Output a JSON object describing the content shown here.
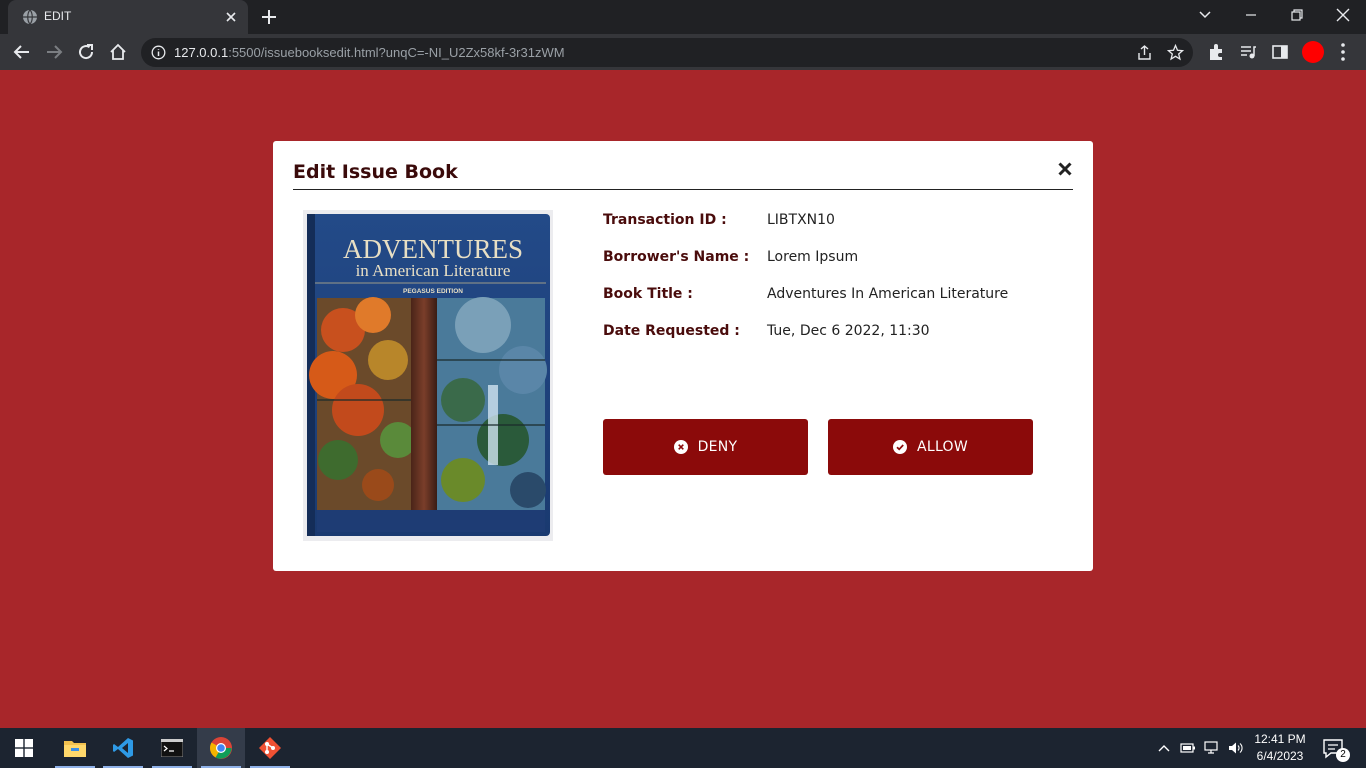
{
  "browser": {
    "tab_title": "EDIT",
    "url_host": "127.0.0.1",
    "url_rest": ":5500/issuebooksedit.html?unqC=-NI_U2Zx58kf-3r31zWM"
  },
  "modal": {
    "title": "Edit Issue Book",
    "details": [
      {
        "label": "Transaction ID :",
        "value": "LIBTXN10"
      },
      {
        "label": "Borrower's Name :",
        "value": "Lorem Ipsum"
      },
      {
        "label": "Book Title :",
        "value": "Adventures In American Literature"
      },
      {
        "label": "Date Requested :",
        "value": "Tue, Dec 6 2022, 11:30"
      }
    ],
    "deny_label": "DENY",
    "allow_label": "ALLOW",
    "cover": {
      "title_line1": "ADVENTURES",
      "title_line2": "in American Literature",
      "edition": "PEGASUS EDITION"
    }
  },
  "taskbar": {
    "time": "12:41 PM",
    "date": "6/4/2023",
    "notification_count": "2"
  },
  "colors": {
    "page_background": "#a8262a",
    "button": "#8b0a0a",
    "label": "#4a0c0c"
  }
}
